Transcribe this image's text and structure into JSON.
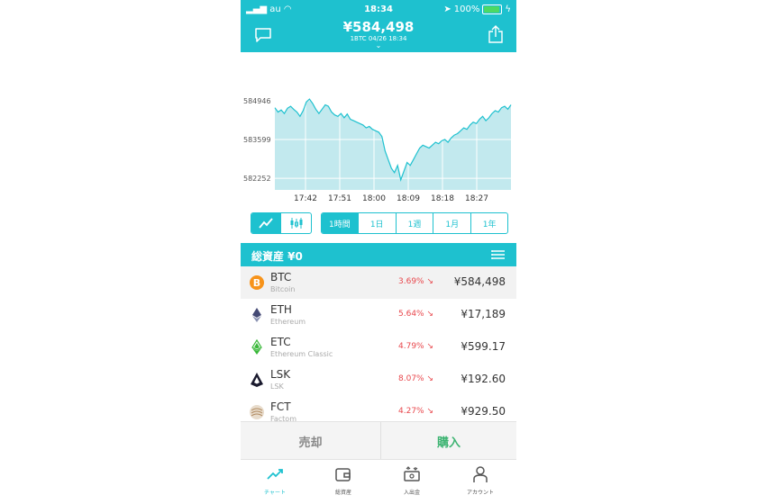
{
  "status": {
    "carrier": "au",
    "time": "18:34",
    "battery": "100%"
  },
  "header": {
    "price": "¥584,498",
    "sub": "1BTC   04/26 18:34"
  },
  "chart_data": {
    "type": "area",
    "x_ticks": [
      "17:42",
      "17:51",
      "18:00",
      "18:09",
      "18:18",
      "18:27"
    ],
    "y_ticks": [
      "584946",
      "583599",
      "582252"
    ],
    "values": [
      584700,
      584550,
      584620,
      584500,
      584680,
      584750,
      584640,
      584550,
      584400,
      584600,
      584900,
      585000,
      584850,
      584650,
      584500,
      584650,
      584800,
      584750,
      584550,
      584450,
      584400,
      584500,
      584350,
      584480,
      584300,
      584250,
      584200,
      584150,
      584100,
      584000,
      584050,
      583950,
      583900,
      583850,
      583700,
      583200,
      582900,
      582600,
      582450,
      582700,
      582200,
      582500,
      582800,
      582700,
      582900,
      583100,
      583300,
      583400,
      583350,
      583300,
      583400,
      583500,
      583450,
      583550,
      583600,
      583500,
      583650,
      583750,
      583800,
      583900,
      584000,
      583950,
      584100,
      584200,
      584150,
      584300,
      584400,
      584250,
      584350,
      584500,
      584600,
      584550,
      584700,
      584750,
      584650,
      584800
    ],
    "ylim": [
      581850,
      586500
    ],
    "grid": true
  },
  "chart_type_toggle": [
    "line-chart-icon",
    "candlestick-icon"
  ],
  "ranges": [
    "1時間",
    "1日",
    "1週",
    "1月",
    "1年"
  ],
  "assets": {
    "title": "総資産 ¥0",
    "rows": [
      {
        "sym": "BTC",
        "name": "Bitcoin",
        "chg": "3.69% ↘",
        "price": "¥584,498",
        "icon": "bitcoin-icon",
        "color": "#f7931a"
      },
      {
        "sym": "ETH",
        "name": "Ethereum",
        "chg": "5.64% ↘",
        "price": "¥17,189",
        "icon": "ethereum-icon",
        "color": "#454a75"
      },
      {
        "sym": "ETC",
        "name": "Ethereum Classic",
        "chg": "4.79% ↘",
        "price": "¥599.17",
        "icon": "ethereum-classic-icon",
        "color": "#3ab83a"
      },
      {
        "sym": "LSK",
        "name": "LSK",
        "chg": "8.07% ↘",
        "price": "¥192.60",
        "icon": "lisk-icon",
        "color": "#1a1a2e"
      },
      {
        "sym": "FCT",
        "name": "Factom",
        "chg": "4.27% ↘",
        "price": "¥929.50",
        "icon": "factom-icon",
        "color": "#c0a080"
      }
    ]
  },
  "actions": {
    "sell": "売却",
    "buy": "購入"
  },
  "tabs": [
    "チャート",
    "総資産",
    "入出金",
    "アカウント"
  ],
  "colors": {
    "accent": "#1ec1cf",
    "down": "#e8474c",
    "buy": "#3cb371"
  }
}
